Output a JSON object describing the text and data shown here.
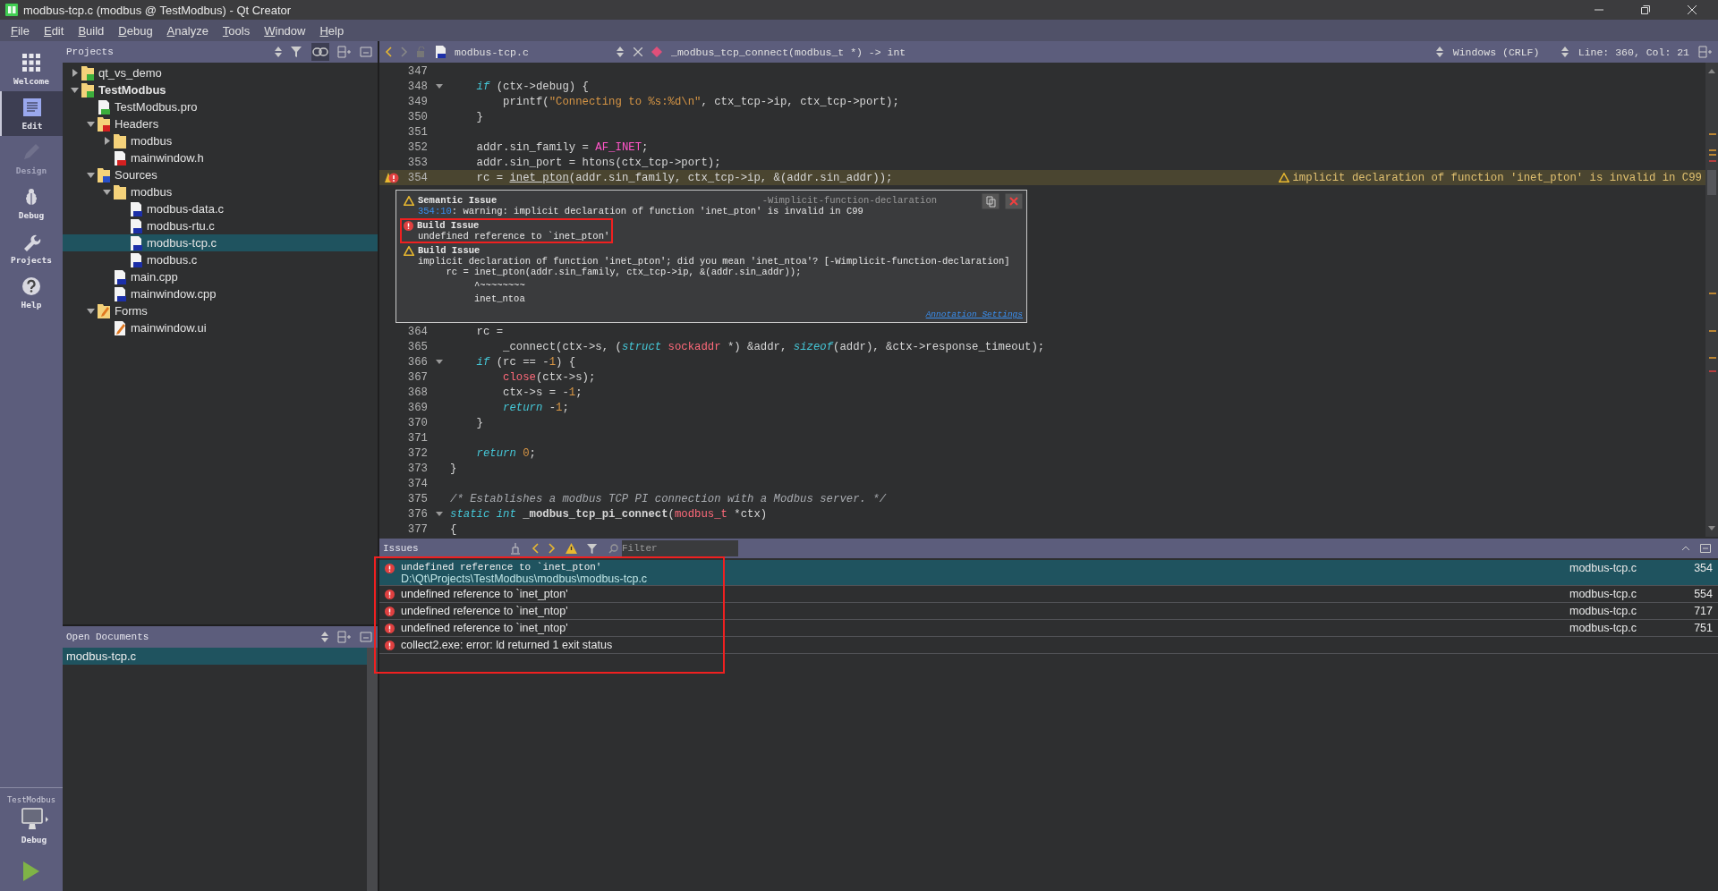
{
  "window": {
    "title": "modbus-tcp.c (modbus @ TestModbus) - Qt Creator"
  },
  "menu": [
    "File",
    "Edit",
    "Build",
    "Debug",
    "Analyze",
    "Tools",
    "Window",
    "Help"
  ],
  "modes": [
    {
      "kind": "welcome",
      "label": "Welcome",
      "selected": false,
      "disabled": false
    },
    {
      "kind": "edit",
      "label": "Edit",
      "selected": true,
      "disabled": false
    },
    {
      "kind": "design",
      "label": "Design",
      "selected": false,
      "disabled": true
    },
    {
      "kind": "debug",
      "label": "Debug",
      "selected": false,
      "disabled": false
    },
    {
      "kind": "projects",
      "label": "Projects",
      "selected": false,
      "disabled": false
    },
    {
      "kind": "help",
      "label": "Help",
      "selected": false,
      "disabled": false
    }
  ],
  "target": {
    "project": "TestModbus",
    "build": "Debug"
  },
  "projects_panel": {
    "title": "Projects",
    "tree": [
      {
        "label": "qt_vs_demo",
        "kind": "project",
        "expanded": false,
        "selected": false
      },
      {
        "label": "TestModbus",
        "kind": "project",
        "bold": true,
        "expanded": true,
        "selected": false,
        "children": [
          {
            "label": "TestModbus.pro",
            "kind": "pro",
            "selected": false
          },
          {
            "label": "Headers",
            "kind": "headers",
            "expanded": true,
            "selected": false,
            "children": [
              {
                "label": "modbus",
                "kind": "folder",
                "expanded": false,
                "selected": false
              },
              {
                "label": "mainwindow.h",
                "kind": "h",
                "selected": false
              }
            ]
          },
          {
            "label": "Sources",
            "kind": "sources",
            "expanded": true,
            "selected": false,
            "children": [
              {
                "label": "modbus",
                "kind": "folder",
                "expanded": true,
                "selected": false,
                "children": [
                  {
                    "label": "modbus-data.c",
                    "kind": "c",
                    "selected": false
                  },
                  {
                    "label": "modbus-rtu.c",
                    "kind": "c",
                    "selected": false
                  },
                  {
                    "label": "modbus-tcp.c",
                    "kind": "c",
                    "selected": true
                  },
                  {
                    "label": "modbus.c",
                    "kind": "c",
                    "selected": false
                  }
                ]
              },
              {
                "label": "main.cpp",
                "kind": "cpp",
                "selected": false
              },
              {
                "label": "mainwindow.cpp",
                "kind": "cpp",
                "selected": false
              }
            ]
          },
          {
            "label": "Forms",
            "kind": "forms",
            "expanded": true,
            "selected": false,
            "children": [
              {
                "label": "mainwindow.ui",
                "kind": "ui",
                "selected": false
              }
            ]
          }
        ]
      }
    ]
  },
  "open_documents": {
    "title": "Open Documents",
    "items": [
      {
        "label": "modbus-tcp.c",
        "selected": true
      }
    ]
  },
  "editor": {
    "file": "modbus-tcp.c",
    "symbol": "_modbus_tcp_connect(modbus_t *) -> int",
    "line_ending": "Windows (CRLF)",
    "position": "Line: 360, Col: 21",
    "lines_top": [
      {
        "number": "347",
        "fold": false
      },
      {
        "number": "348",
        "fold": true,
        "tokens": [
          {
            "kind": "keyword",
            "text": "    if"
          },
          {
            "kind": "plain",
            "text": " (ctx->debug) {"
          }
        ]
      },
      {
        "number": "349",
        "fold": false,
        "tokens": [
          {
            "kind": "plain",
            "text": "        printf("
          },
          {
            "kind": "string",
            "text": "\"Connecting to %s:%d\\n\""
          },
          {
            "kind": "plain",
            "text": ", ctx_tcp->ip, ctx_tcp->port);"
          }
        ]
      },
      {
        "number": "350",
        "fold": false,
        "tokens": [
          {
            "kind": "plain",
            "text": "    }"
          }
        ]
      },
      {
        "number": "351",
        "fold": false
      },
      {
        "number": "352",
        "fold": false,
        "tokens": [
          {
            "kind": "plain",
            "text": "    addr.sin_family = "
          },
          {
            "kind": "macro",
            "text": "AF_INET"
          },
          {
            "kind": "plain",
            "text": ";"
          }
        ]
      },
      {
        "number": "353",
        "fold": false,
        "tokens": [
          {
            "kind": "plain",
            "text": "    addr.sin_port = htons(ctx_tcp->port);"
          }
        ]
      },
      {
        "number": "354",
        "fold": false,
        "error_marker": true,
        "highlighted": true,
        "annotation": "implicit declaration of function 'inet_pton' is invalid in C99",
        "tokens": [
          {
            "kind": "plain",
            "text": "    rc = "
          },
          {
            "kind": "underlined",
            "text": "inet_pton"
          },
          {
            "kind": "plain",
            "text": "(addr.sin_family, ctx_tcp->ip, &(addr.sin_addr));"
          }
        ]
      }
    ],
    "tooltip": {
      "entries": [
        {
          "kind": "warning",
          "title": "Semantic Issue",
          "option": "-Wimplicit-function-declaration",
          "location": "354:10",
          "message": ": warning: implicit declaration of function 'inet_pton' is invalid in C99",
          "outlined": false
        },
        {
          "kind": "error",
          "title": "Build Issue",
          "message": "undefined reference to `inet_pton'",
          "outlined": true
        },
        {
          "kind": "warning",
          "title": "Build Issue",
          "message": "implicit declaration of function 'inet_pton'; did you mean 'inet_ntoa'? [-Wimplicit-function-declaration]",
          "details": [
            "     rc = inet_pton(addr.sin_family, ctx_tcp->ip, &(addr.sin_addr));",
            "          ^~~~~~~~~",
            "          inet_ntoa"
          ],
          "outlined": false
        }
      ],
      "link": "Annotation Settings"
    },
    "lines_bottom": [
      {
        "number": "364",
        "fold": false,
        "tokens": [
          {
            "kind": "plain",
            "text": "    rc ="
          }
        ]
      },
      {
        "number": "365",
        "fold": false,
        "tokens": [
          {
            "kind": "plain",
            "text": "        _connect(ctx->s, ("
          },
          {
            "kind": "keyword",
            "text": "struct"
          },
          {
            "kind": "type",
            "text": " sockaddr"
          },
          {
            "kind": "plain",
            "text": " *) &addr, "
          },
          {
            "kind": "keyword",
            "text": "sizeof"
          },
          {
            "kind": "plain",
            "text": "(addr), &ctx->response_timeout);"
          }
        ]
      },
      {
        "number": "366",
        "fold": true,
        "tokens": [
          {
            "kind": "keyword",
            "text": "    if"
          },
          {
            "kind": "plain",
            "text": " (rc == -"
          },
          {
            "kind": "number",
            "text": "1"
          },
          {
            "kind": "plain",
            "text": ") {"
          }
        ]
      },
      {
        "number": "367",
        "fold": false,
        "tokens": [
          {
            "kind": "type",
            "text": "        close"
          },
          {
            "kind": "plain",
            "text": "(ctx->s);"
          }
        ]
      },
      {
        "number": "368",
        "fold": false,
        "tokens": [
          {
            "kind": "plain",
            "text": "        ctx->s = -"
          },
          {
            "kind": "number",
            "text": "1"
          },
          {
            "kind": "plain",
            "text": ";"
          }
        ]
      },
      {
        "number": "369",
        "fold": false,
        "tokens": [
          {
            "kind": "keyword",
            "text": "        return"
          },
          {
            "kind": "plain",
            "text": " -"
          },
          {
            "kind": "number",
            "text": "1"
          },
          {
            "kind": "plain",
            "text": ";"
          }
        ]
      },
      {
        "number": "370",
        "fold": false,
        "tokens": [
          {
            "kind": "plain",
            "text": "    }"
          }
        ]
      },
      {
        "number": "371",
        "fold": false
      },
      {
        "number": "372",
        "fold": false,
        "tokens": [
          {
            "kind": "keyword",
            "text": "    return"
          },
          {
            "kind": "number",
            "text": " 0"
          },
          {
            "kind": "plain",
            "text": ";"
          }
        ]
      },
      {
        "number": "373",
        "fold": false,
        "tokens": [
          {
            "kind": "plain",
            "text": "}"
          }
        ]
      },
      {
        "number": "374",
        "fold": false
      },
      {
        "number": "375",
        "fold": false,
        "tokens": [
          {
            "kind": "comment",
            "text": "/* Establishes a modbus TCP PI connection with a Modbus server. */"
          }
        ]
      },
      {
        "number": "376",
        "fold": true,
        "tokens": [
          {
            "kind": "keyword",
            "text": "static int"
          },
          {
            "kind": "funcdef",
            "text": " _modbus_tcp_pi_connect"
          },
          {
            "kind": "plain",
            "text": "("
          },
          {
            "kind": "type",
            "text": "modbus_t"
          },
          {
            "kind": "plain",
            "text": " *ctx)"
          }
        ]
      },
      {
        "number": "377",
        "fold": false,
        "tokens": [
          {
            "kind": "plain",
            "text": "{"
          }
        ]
      }
    ]
  },
  "issues": {
    "title": "Issues",
    "filter_placeholder": "Filter",
    "outlined": true,
    "rows": [
      {
        "error": true,
        "message": "undefined reference to `inet_pton'",
        "path": "D:\\Qt\\Projects\\TestModbus\\modbus\\modbus-tcp.c",
        "file": "modbus-tcp.c",
        "line": "354",
        "selected": true
      },
      {
        "error": true,
        "message": "undefined reference to `inet_pton'",
        "file": "modbus-tcp.c",
        "line": "554",
        "selected": false
      },
      {
        "error": true,
        "message": "undefined reference to `inet_ntop'",
        "file": "modbus-tcp.c",
        "line": "717",
        "selected": false
      },
      {
        "error": true,
        "message": "undefined reference to `inet_ntop'",
        "file": "modbus-tcp.c",
        "line": "751",
        "selected": false
      },
      {
        "error": true,
        "message": "collect2.exe: error: ld returned 1 exit status",
        "selected": false
      }
    ]
  }
}
